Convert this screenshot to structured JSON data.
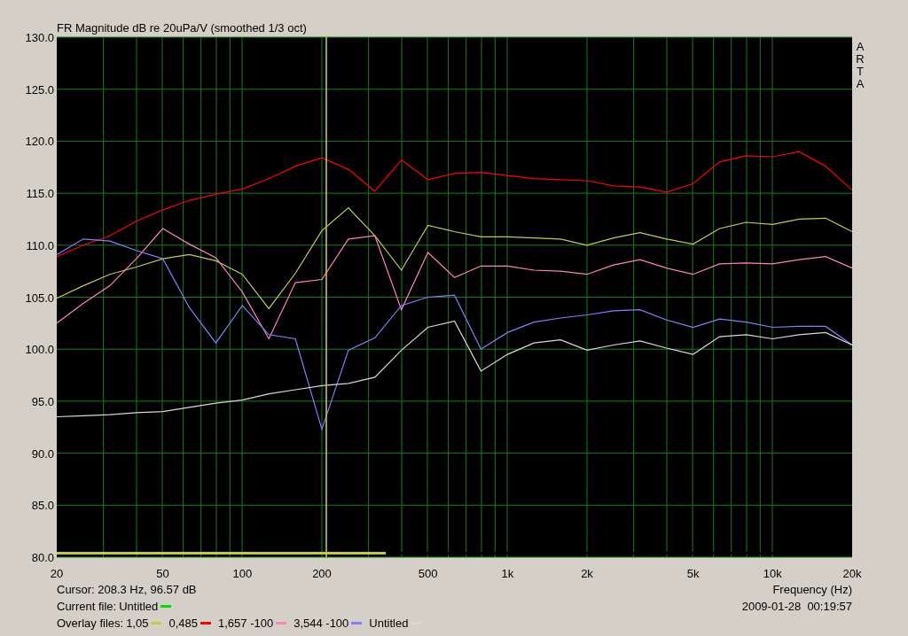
{
  "chart": {
    "chart_data": {
      "type": "line",
      "title": "FR Magnitude dB re 20uPa/V (smoothed 1/3 oct)",
      "xlabel": "Frequency (Hz)",
      "categories": [
        "20",
        null,
        null,
        null,
        "50",
        null,
        null,
        "100",
        null,
        null,
        "200",
        null,
        null,
        null,
        "500",
        null,
        null,
        "1k",
        null,
        null,
        "2k",
        null,
        null,
        null,
        "5k",
        null,
        null,
        "10k",
        null,
        null,
        "20k"
      ],
      "series": [
        {
          "name": "1,05",
          "color": "#c8c850",
          "values": [
            104.9,
            106.1,
            107.2,
            107.9,
            108.7,
            109.1,
            108.5,
            107.2,
            103.9,
            107.3,
            111.4,
            113.6,
            110.9,
            107.6,
            111.9,
            111.3,
            110.8,
            110.8,
            110.7,
            110.6,
            110,
            110.7,
            111.2,
            110.6,
            110.1,
            111.6,
            112.2,
            112,
            112.5,
            112.6,
            111.3
          ]
        },
        {
          "name": "0,485",
          "color": "#ff0000",
          "values": [
            108.9,
            110,
            110.9,
            112.3,
            113.4,
            114.3,
            114.9,
            115.4,
            116.4,
            117.6,
            118.4,
            117.3,
            115.2,
            118.2,
            116.3,
            116.9,
            117,
            116.7,
            116.4,
            116.3,
            116.2,
            115.7,
            115.6,
            115.1,
            115.9,
            118,
            118.6,
            118.5,
            119,
            117.6,
            115.3
          ]
        },
        {
          "name": "1,657 -100",
          "color": "#ff80c0",
          "values": [
            102.5,
            104.4,
            106.1,
            108.7,
            111.6,
            110.1,
            108.8,
            105.5,
            101,
            106.4,
            106.7,
            110.6,
            110.9,
            103.8,
            109.3,
            106.9,
            108,
            108,
            107.6,
            107.5,
            107.2,
            108.1,
            108.6,
            107.8,
            107.2,
            108.2,
            108.3,
            108.2,
            108.6,
            108.9,
            107.8
          ]
        },
        {
          "name": "3,544 -100",
          "color": "#8080ff",
          "values": [
            109.1,
            110.6,
            110.4,
            109.5,
            108.7,
            104,
            100.6,
            104.2,
            101.4,
            101,
            92.3,
            99.9,
            101.1,
            104.2,
            105,
            105.2,
            100,
            101.6,
            102.6,
            103,
            103.3,
            103.7,
            103.8,
            102.8,
            102.1,
            102.9,
            102.6,
            102.1,
            102.2,
            102.2,
            100.4
          ]
        },
        {
          "name": "Untitled",
          "color": "#d8d8d8",
          "values": [
            93.5,
            93.6,
            93.7,
            93.9,
            94,
            94.4,
            94.8,
            95.1,
            95.7,
            96.1,
            96.5,
            96.7,
            97.3,
            99.9,
            102.1,
            102.7,
            97.9,
            99.5,
            100.6,
            100.9,
            99.9,
            100.4,
            100.8,
            100.1,
            99.5,
            101.2,
            101.4,
            101,
            101.4,
            101.6,
            100.4
          ]
        }
      ],
      "ylim": [
        80,
        130
      ],
      "grid": true,
      "yticks": [
        {
          "value": 80,
          "label": "80.0"
        },
        {
          "value": 85,
          "label": "85.0"
        },
        {
          "value": 90,
          "label": "90.0"
        },
        {
          "value": 95,
          "label": "95.0"
        },
        {
          "value": 100,
          "label": "100.0"
        },
        {
          "value": 105,
          "label": "105.0"
        },
        {
          "value": 110,
          "label": "110.0"
        },
        {
          "value": 115,
          "label": "115.0"
        },
        {
          "value": 120,
          "label": "120.0"
        },
        {
          "value": 125,
          "label": "125.0"
        },
        {
          "value": 130,
          "label": "130.0"
        }
      ]
    },
    "cursor": {
      "level": 0.339
    },
    "range_bar": {
      "level": 0.414
    },
    "brand": "ARTA"
  },
  "footer": {
    "cursor": "Cursor: 208.3 Hz, 96.57 dB",
    "current_file_label": "Current file:",
    "current_file": {
      "name": "Untitled",
      "color": "#00e000"
    },
    "overlay_label": "Overlay files:",
    "timestamp": "2009-01-28  00:19:57"
  }
}
